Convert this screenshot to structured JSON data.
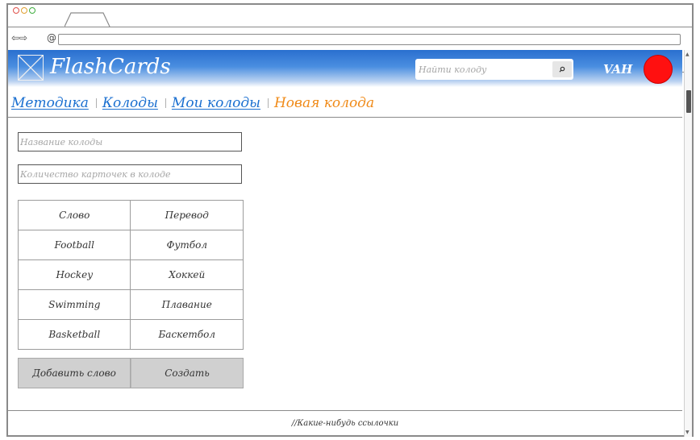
{
  "browser": {
    "nav_arrows": "⇦⇨",
    "url_icon": "@",
    "url": ""
  },
  "header": {
    "brand": "FlashCards",
    "search_placeholder": "Найти колоду",
    "username": "VAH",
    "avatar_color": "#ff1010",
    "header_color": "#2a6fcf"
  },
  "breadcrumb": [
    {
      "label": "Методика"
    },
    {
      "label": "Колоды"
    },
    {
      "label": "Мои колоды"
    },
    {
      "label": "Новая колода"
    }
  ],
  "form": {
    "deck_name_placeholder": "Название колоды",
    "card_count_placeholder": "Количество карточек в колоде"
  },
  "words_table": {
    "header": [
      "Слово",
      "Перевод"
    ],
    "rows": [
      [
        "Football",
        "Футбол"
      ],
      [
        "Hockey",
        "Хоккей"
      ],
      [
        "Swimming",
        "Плавание"
      ],
      [
        "Basketball",
        "Баскетбол"
      ]
    ]
  },
  "buttons": {
    "add_word": "Добавить слово",
    "create": "Создать"
  },
  "footer": {
    "text": "//Какие-нибудь ссылочки"
  },
  "colors": {
    "link": "#1a6fd0",
    "active_link": "#f08a17",
    "button_bg": "#d0d0d0"
  }
}
